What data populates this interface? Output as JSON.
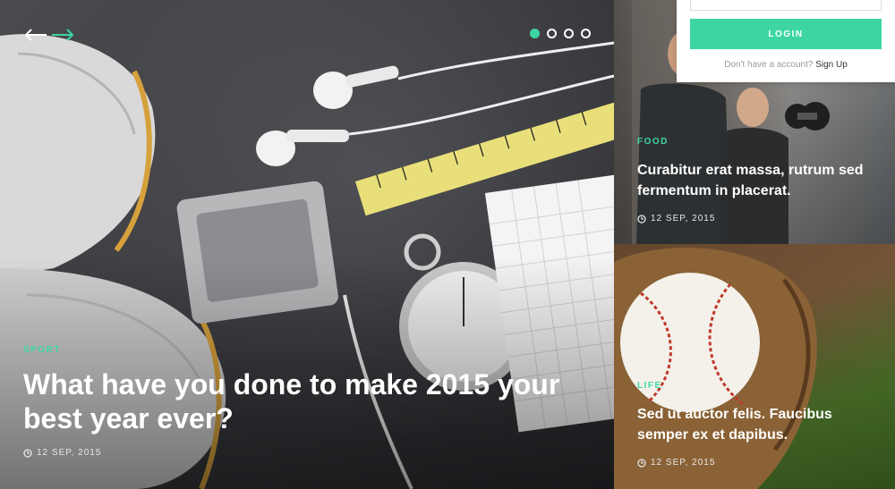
{
  "colors": {
    "accent": "#3dd6a3",
    "text_light": "#ffffff"
  },
  "slider": {
    "prev_icon": "arrow-left-icon",
    "next_icon": "arrow-right-icon",
    "dots": [
      {
        "active": true
      },
      {
        "active": false
      },
      {
        "active": false
      },
      {
        "active": false
      }
    ]
  },
  "featured": {
    "category": "SPORT",
    "title": "What have you done to make 2015 your best year ever?",
    "date": "12 SEP, 2015",
    "date_icon": "clock-icon"
  },
  "side_posts": [
    {
      "category": "FOOD",
      "title": "Curabitur erat massa, rutrum sed fermentum in placerat.",
      "date": "12 SEP, 2015"
    },
    {
      "category": "LIFE",
      "title": "Sed ut auctor felis. Faucibus semper ex et dapibus.",
      "date": "12 SEP, 2015"
    }
  ],
  "login": {
    "input_value": "",
    "button_label": "LOGIN",
    "signup_prompt": "Don't have a account?",
    "signup_link": "Sign Up"
  }
}
